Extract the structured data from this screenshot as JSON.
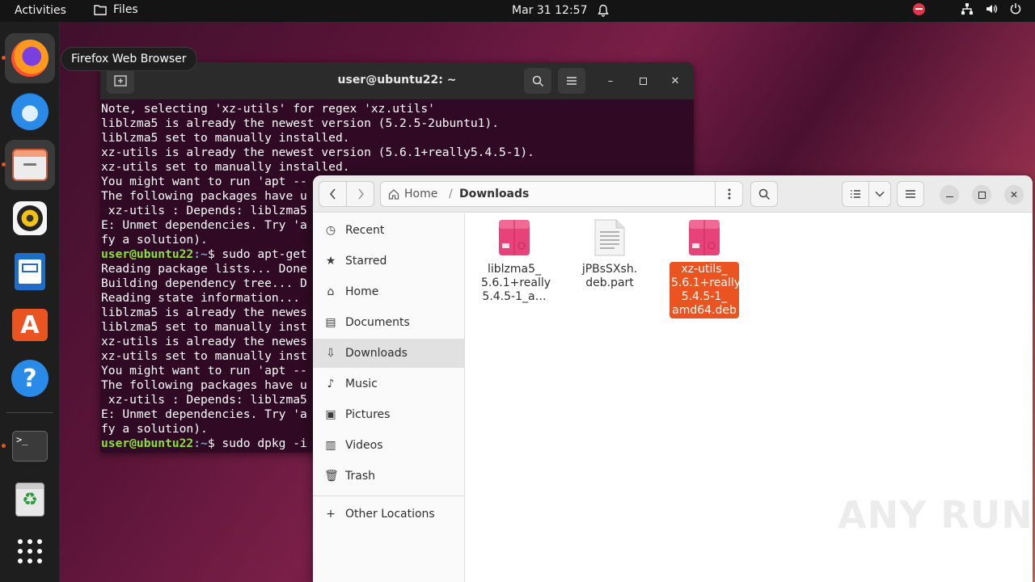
{
  "topbar": {
    "activities": "Activities",
    "app_menu": "Files",
    "clock": "Mar 31  12:57"
  },
  "dock": {
    "tooltip": "Firefox Web Browser",
    "items": [
      "firefox",
      "thunderbird",
      "files",
      "rhythmbox",
      "libreoffice-writer",
      "ubuntu-software",
      "help",
      "terminal",
      "trash",
      "show-apps"
    ]
  },
  "terminal": {
    "title": "user@ubuntu22: ~",
    "lines": [
      "Note, selecting 'xz-utils' for regex 'xz.utils'",
      "liblzma5 is already the newest version (5.2.5-2ubuntu1).",
      "liblzma5 set to manually installed.",
      "xz-utils is already the newest version (5.6.1+really5.4.5-1).",
      "xz-utils set to manually installed.",
      "You might want to run 'apt --",
      "The following packages have u",
      " xz-utils : Depends: liblzma5",
      "E: Unmet dependencies. Try 'a",
      "fy a solution)."
    ],
    "prompt_user": "user@ubuntu22",
    "prompt_path": ":~",
    "prompt_symbol": "$ ",
    "cmd1": "sudo apt-get",
    "lines2": [
      "Reading package lists... Done",
      "Building dependency tree... D",
      "Reading state information...",
      "liblzma5 is already the newes",
      "liblzma5 set to manually inst",
      "xz-utils is already the newes",
      "xz-utils set to manually inst",
      "You might want to run 'apt --",
      "The following packages have u",
      " xz-utils : Depends: liblzma5",
      "E: Unmet dependencies. Try 'a",
      "fy a solution)."
    ],
    "cmd2": "sudo dpkg -i"
  },
  "files": {
    "path_home": "Home",
    "path_sep": "/",
    "path_current": "Downloads",
    "sidebar": [
      {
        "label": "Recent",
        "icon": "clock-icon"
      },
      {
        "label": "Starred",
        "icon": "star-icon"
      },
      {
        "label": "Home",
        "icon": "home-icon"
      },
      {
        "label": "Documents",
        "icon": "document-icon"
      },
      {
        "label": "Downloads",
        "icon": "download-icon"
      },
      {
        "label": "Music",
        "icon": "music-icon"
      },
      {
        "label": "Pictures",
        "icon": "picture-icon"
      },
      {
        "label": "Videos",
        "icon": "video-icon"
      },
      {
        "label": "Trash",
        "icon": "trash-icon"
      }
    ],
    "other_locations": "Other Locations",
    "items": [
      {
        "line1": "liblzma5_",
        "line2": "5.6.1+really",
        "line3": "5.4.5-1_a…"
      },
      {
        "line1": "jPBsSXsh.",
        "line2": "deb.part"
      },
      {
        "line1": "xz-utils_",
        "line2": "5.6.1+really",
        "line3": "5.4.5-1_",
        "line4": "amd64.deb"
      }
    ]
  },
  "watermark": "ANY RUN",
  "colors": {
    "accent": "#e95420",
    "terminal_bg": "#300a24",
    "prompt_user": "#8ae234",
    "prompt_path": "#729fcf",
    "deb_pink": "#e8427a"
  }
}
